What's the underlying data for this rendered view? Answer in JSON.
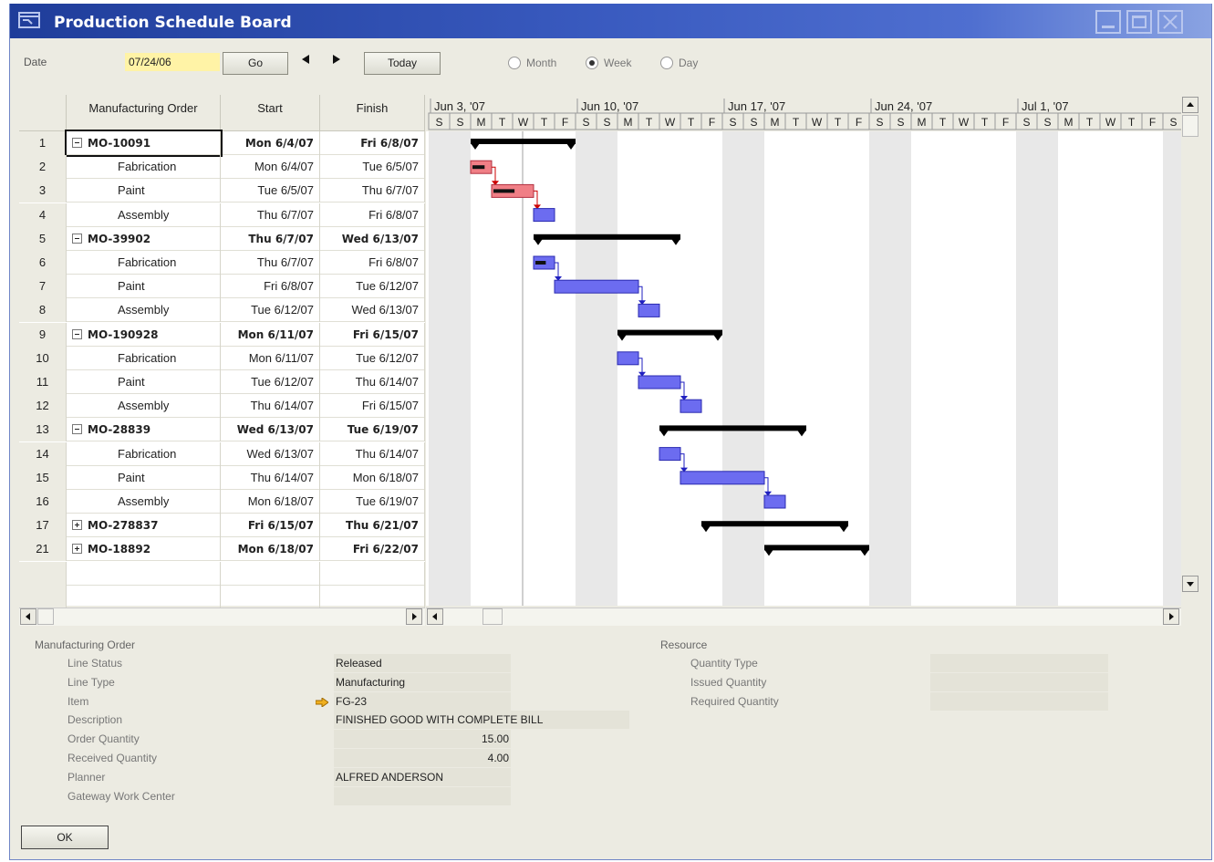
{
  "window": {
    "title": "Production Schedule Board"
  },
  "toolbar": {
    "date_label": "Date",
    "date_value": "07/24/06",
    "go_label": "Go",
    "today_label": "Today",
    "view_options": [
      "Month",
      "Week",
      "Day"
    ],
    "selected_view": "Week"
  },
  "grid": {
    "headers": {
      "order": "Manufacturing Order",
      "start": "Start",
      "finish": "Finish"
    },
    "rows": [
      {
        "num": "1",
        "order": "MO-10091",
        "start": "Mon 6/4/07",
        "finish": "Fri 6/8/07",
        "level": 0,
        "expanded": true
      },
      {
        "num": "2",
        "order": "Fabrication",
        "start": "Mon 6/4/07",
        "finish": "Tue 6/5/07",
        "level": 1
      },
      {
        "num": "3",
        "order": "Paint",
        "start": "Tue 6/5/07",
        "finish": "Thu 6/7/07",
        "level": 1
      },
      {
        "num": "4",
        "order": "Assembly",
        "start": "Thu 6/7/07",
        "finish": "Fri 6/8/07",
        "level": 1
      },
      {
        "num": "5",
        "order": "MO-39902",
        "start": "Thu 6/7/07",
        "finish": "Wed 6/13/07",
        "level": 0,
        "expanded": true
      },
      {
        "num": "6",
        "order": "Fabrication",
        "start": "Thu 6/7/07",
        "finish": "Fri 6/8/07",
        "level": 1
      },
      {
        "num": "7",
        "order": "Paint",
        "start": "Fri 6/8/07",
        "finish": "Tue 6/12/07",
        "level": 1
      },
      {
        "num": "8",
        "order": "Assembly",
        "start": "Tue 6/12/07",
        "finish": "Wed 6/13/07",
        "level": 1
      },
      {
        "num": "9",
        "order": "MO-190928",
        "start": "Mon 6/11/07",
        "finish": "Fri 6/15/07",
        "level": 0,
        "expanded": true
      },
      {
        "num": "10",
        "order": "Fabrication",
        "start": "Mon 6/11/07",
        "finish": "Tue 6/12/07",
        "level": 1
      },
      {
        "num": "11",
        "order": "Paint",
        "start": "Tue 6/12/07",
        "finish": "Thu 6/14/07",
        "level": 1
      },
      {
        "num": "12",
        "order": "Assembly",
        "start": "Thu 6/14/07",
        "finish": "Fri 6/15/07",
        "level": 1
      },
      {
        "num": "13",
        "order": "MO-28839",
        "start": "Wed 6/13/07",
        "finish": "Tue 6/19/07",
        "level": 0,
        "expanded": true
      },
      {
        "num": "14",
        "order": "Fabrication",
        "start": "Wed 6/13/07",
        "finish": "Thu 6/14/07",
        "level": 1
      },
      {
        "num": "15",
        "order": "Paint",
        "start": "Thu 6/14/07",
        "finish": "Mon 6/18/07",
        "level": 1
      },
      {
        "num": "16",
        "order": "Assembly",
        "start": "Mon 6/18/07",
        "finish": "Tue 6/19/07",
        "level": 1
      },
      {
        "num": "17",
        "order": "MO-278837",
        "start": "Fri 6/15/07",
        "finish": "Thu 6/21/07",
        "level": 0,
        "expanded": false
      },
      {
        "num": "21",
        "order": "MO-18892",
        "start": "Mon 6/18/07",
        "finish": "Fri 6/22/07",
        "level": 0,
        "expanded": false
      }
    ]
  },
  "gantt": {
    "weeks": [
      "Jun 3, '07",
      "Jun 10, '07",
      "Jun 17, '07",
      "Jun 24, '07",
      "Jul 1, '07"
    ],
    "day_letters": [
      "S",
      "M",
      "T",
      "W",
      "T",
      "F",
      "S"
    ],
    "timeline_start": "2007-06-02",
    "today": "2007-06-06",
    "colors": {
      "summary": "#000000",
      "red_task": "#f07f86",
      "blue_task": "#6c6cf0",
      "weekend": "#e8e8e8",
      "connector_red": "#cc0000",
      "connector_blue": "#1f1fc0"
    },
    "bars": [
      {
        "row": 0,
        "kind": "summary",
        "start": "2007-06-04",
        "end": "2007-06-09"
      },
      {
        "row": 1,
        "kind": "task",
        "color": "red",
        "start": "2007-06-04",
        "end": "2007-06-05",
        "progress": 0.7
      },
      {
        "row": 2,
        "kind": "task",
        "color": "red",
        "start": "2007-06-05",
        "end": "2007-06-07",
        "progress": 0.55
      },
      {
        "row": 3,
        "kind": "task",
        "color": "blue",
        "start": "2007-06-07",
        "end": "2007-06-08",
        "progress": 0
      },
      {
        "row": 4,
        "kind": "summary",
        "start": "2007-06-07",
        "end": "2007-06-14"
      },
      {
        "row": 5,
        "kind": "task",
        "color": "blue",
        "start": "2007-06-07",
        "end": "2007-06-08",
        "progress": 0.6
      },
      {
        "row": 6,
        "kind": "task",
        "color": "blue",
        "start": "2007-06-08",
        "end": "2007-06-12",
        "progress": 0
      },
      {
        "row": 7,
        "kind": "task",
        "color": "blue",
        "start": "2007-06-12",
        "end": "2007-06-13",
        "progress": 0
      },
      {
        "row": 8,
        "kind": "summary",
        "start": "2007-06-11",
        "end": "2007-06-16"
      },
      {
        "row": 9,
        "kind": "task",
        "color": "blue",
        "start": "2007-06-11",
        "end": "2007-06-12",
        "progress": 0
      },
      {
        "row": 10,
        "kind": "task",
        "color": "blue",
        "start": "2007-06-12",
        "end": "2007-06-14",
        "progress": 0
      },
      {
        "row": 11,
        "kind": "task",
        "color": "blue",
        "start": "2007-06-14",
        "end": "2007-06-15",
        "progress": 0
      },
      {
        "row": 12,
        "kind": "summary",
        "start": "2007-06-13",
        "end": "2007-06-20"
      },
      {
        "row": 13,
        "kind": "task",
        "color": "blue",
        "start": "2007-06-13",
        "end": "2007-06-14",
        "progress": 0
      },
      {
        "row": 14,
        "kind": "task",
        "color": "blue",
        "start": "2007-06-14",
        "end": "2007-06-18",
        "progress": 0
      },
      {
        "row": 15,
        "kind": "task",
        "color": "blue",
        "start": "2007-06-18",
        "end": "2007-06-19",
        "progress": 0
      },
      {
        "row": 16,
        "kind": "summary",
        "start": "2007-06-15",
        "end": "2007-06-22"
      },
      {
        "row": 17,
        "kind": "summary",
        "start": "2007-06-18",
        "end": "2007-06-23"
      }
    ]
  },
  "details": {
    "mo_title": "Manufacturing Order",
    "fields": [
      {
        "label": "Line Status",
        "value": "Released"
      },
      {
        "label": "Line Type",
        "value": "Manufacturing"
      },
      {
        "label": "Item",
        "value": "FG-23"
      },
      {
        "label": "Description",
        "value": "FINISHED GOOD WITH COMPLETE BILL"
      },
      {
        "label": "Order Quantity",
        "value": "15.00"
      },
      {
        "label": "Received Quantity",
        "value": "4.00"
      },
      {
        "label": "Planner",
        "value": "ALFRED ANDERSON"
      },
      {
        "label": "Gateway Work Center",
        "value": ""
      }
    ],
    "resource_title": "Resource",
    "resource_fields": [
      {
        "label": "Quantity Type",
        "value": ""
      },
      {
        "label": "Issued Quantity",
        "value": ""
      },
      {
        "label": "Required Quantity",
        "value": ""
      }
    ]
  },
  "footer": {
    "ok_label": "OK"
  }
}
